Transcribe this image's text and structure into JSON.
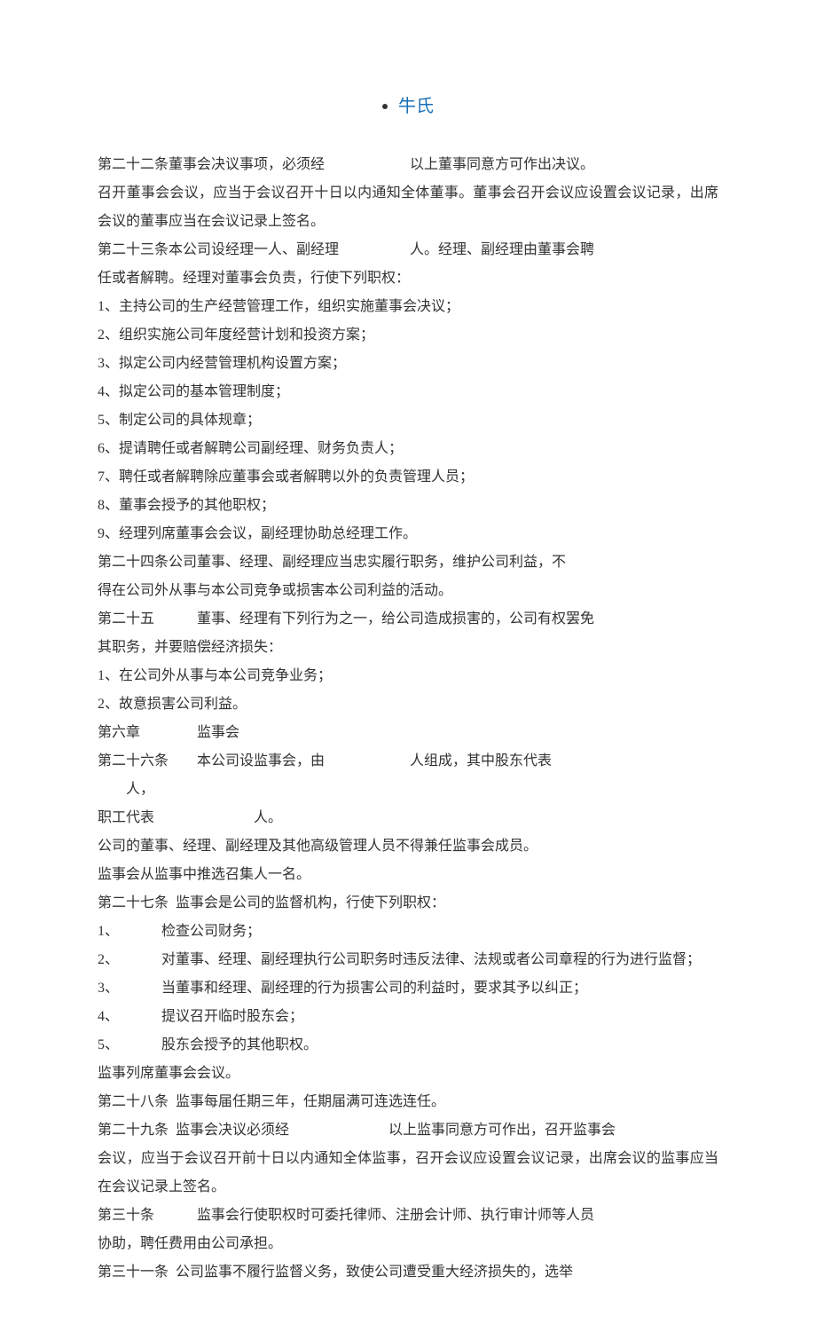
{
  "header": {
    "brand": "牛氏"
  },
  "body": {
    "p1": "第二十二条董事会决议事项，必须经　　　　　　以上董事同意方可作出决议。",
    "p2": "召开董事会会议，应当于会议召开十日以内通知全体董事。董事会召开会议应设置会议记录，出席会议的董事应当在会议记录上签名。",
    "p3": "第二十三条本公司设经理一人、副经理　　　　　人。经理、副经理由董事会聘",
    "p4": "任或者解聘。经理对董事会负责，行使下列职权：",
    "l1": "1、主持公司的生产经营管理工作，组织实施董事会决议；",
    "l2": "2、组织实施公司年度经营计划和投资方案；",
    "l3": "3、拟定公司内经营管理机构设置方案；",
    "l4": "4、拟定公司的基本管理制度；",
    "l5": "5、制定公司的具体规章；",
    "l6": "6、提请聘任或者解聘公司副经理、财务负责人；",
    "l7": "7、聘任或者解聘除应董事会或者解聘以外的负责管理人员；",
    "l8": "8、董事会授予的其他职权；",
    "l9": "9、经理列席董事会会议，副经理协助总经理工作。",
    "p5": "第二十四条公司董事、经理、副经理应当忠实履行职务，维护公司利益，不",
    "p6": "得在公司外从事与本公司竞争或损害本公司利益的活动。",
    "p7": "第二十五　　　董事、经理有下列行为之一，给公司造成损害的，公司有权罢免",
    "p8": "其职务，并要赔偿经济损失：",
    "l10": "1、在公司外从事与本公司竞争业务；",
    "l11": "2、故意损害公司利益。",
    "ch6": "第六章　　　　监事会",
    "a26a": "第二十六条",
    "a26b": "本公司设监事会，由　　　　　　人组成，其中股东代表",
    "a26c": "　　人，",
    "p9": "职工代表　　　　　　　人。",
    "p10": "公司的董事、经理、副经理及其他高级管理人员不得兼任监事会成员。",
    "p11": "监事会从监事中推选召集人一名。",
    "a27a": "第二十七条",
    "a27b": "监事会是公司的监督机构，行使下列职权：",
    "n1a": "1、",
    "n1b": "检查公司财务；",
    "n2a": "2、",
    "n2b": "对董事、经理、副经理执行公司职务时违反法律、法规或者公司章程的行为进行监督；",
    "n3a": "3、",
    "n3b": "当董事和经理、副经理的行为损害公司的利益时，要求其予以纠正；",
    "n4a": "4、",
    "n4b": "提议召开临时股东会；",
    "n5a": "5、",
    "n5b": "股东会授予的其他职权。",
    "p12": "监事列席董事会会议。",
    "a28a": "第二十八条",
    "a28b": "监事每届任期三年，任期届满可连选连任。",
    "a29a": "第二十九条",
    "a29b": "监事会决议必须经　　　　　　　以上监事同意方可作出，召开监事会",
    "p13": "会议，应当于会议召开前十日以内通知全体监事，召开会议应设置会议记录，出席会议的监事应当在会议记录上签名。",
    "a30a": "第三十条",
    "a30b": "监事会行使职权时可委托律师、注册会计师、执行审计师等人员",
    "p14": "协助，聘任费用由公司承担。",
    "a31a": "第三十一条",
    "a31b": "公司监事不履行监督义务，致使公司遭受重大经济损失的，选举"
  }
}
